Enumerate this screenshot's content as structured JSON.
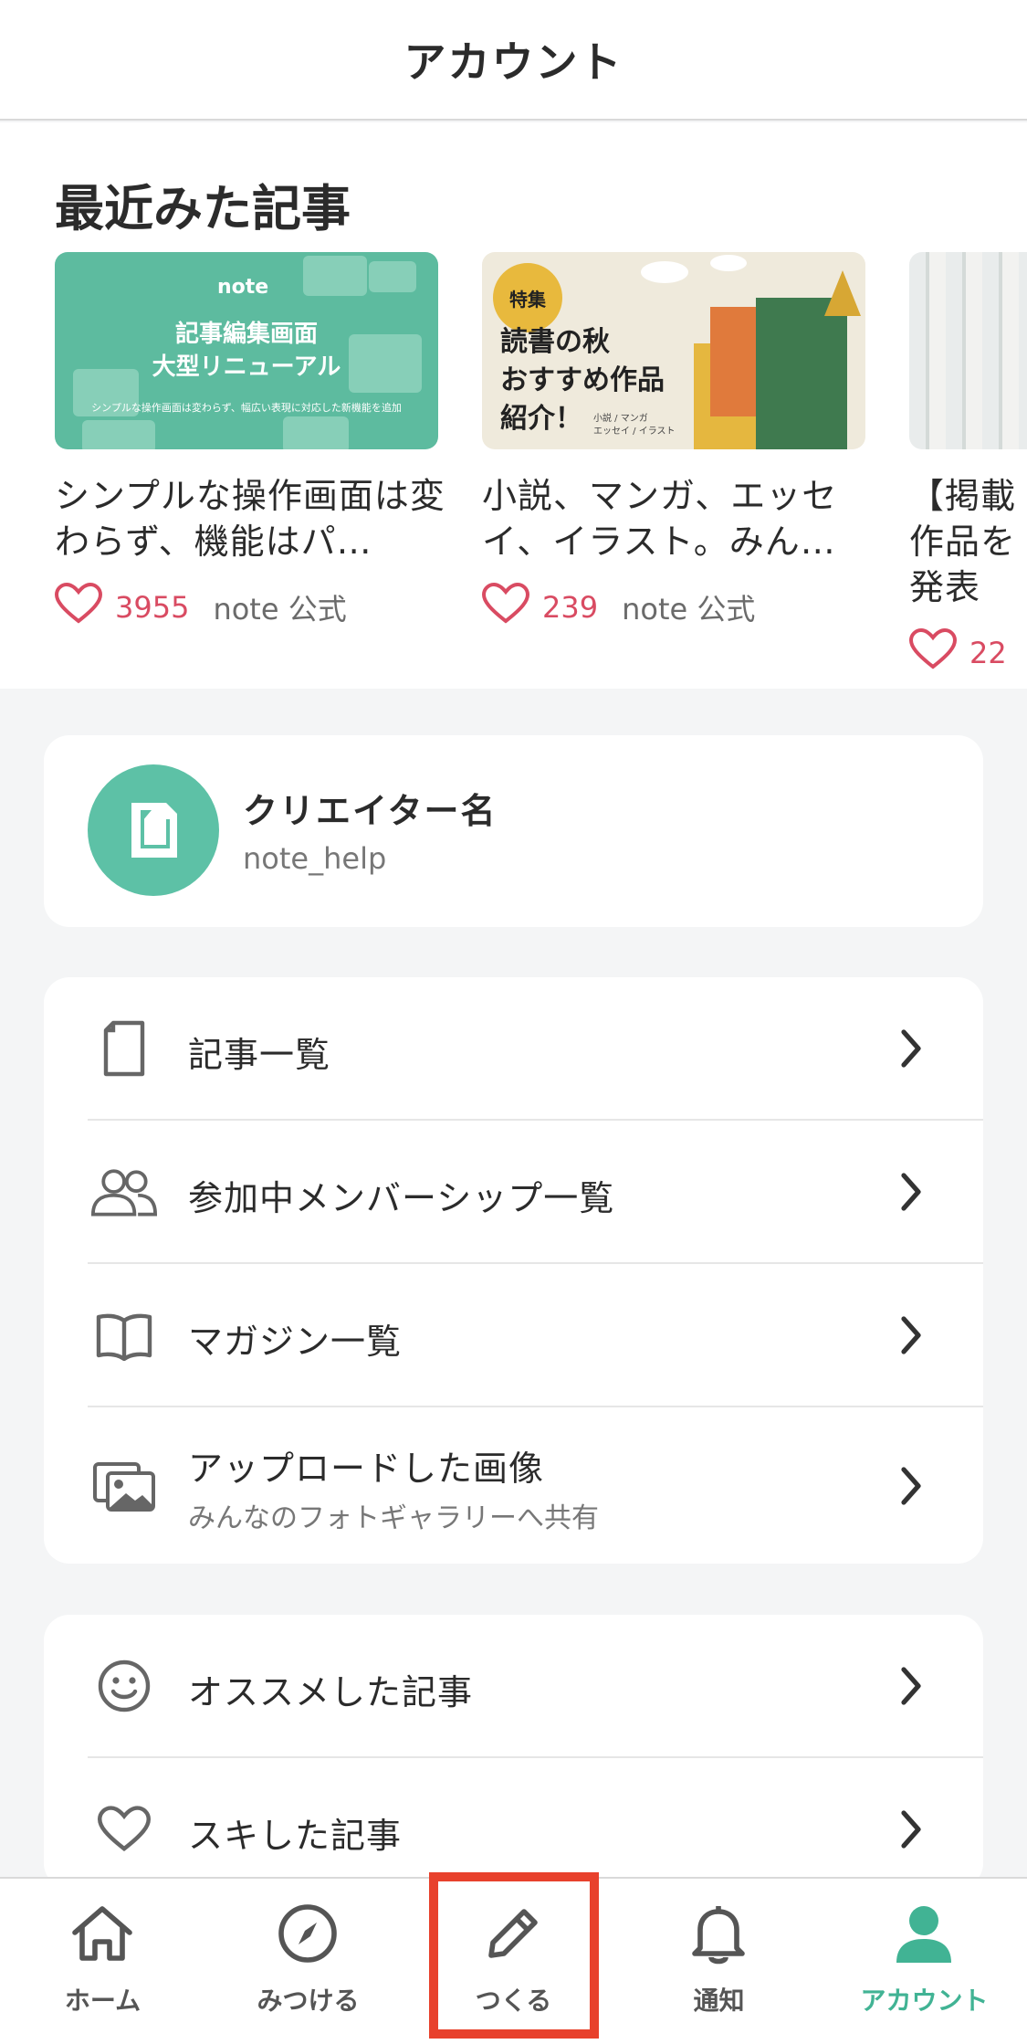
{
  "header": {
    "title": "アカウント"
  },
  "recent": {
    "heading": "最近みた記事",
    "cards": [
      {
        "thumb": {
          "logo": "note",
          "title_line1": "記事編集画面",
          "title_line2": "大型リニューアル",
          "subtitle": "シンプルな操作画面は変わらず、幅広い表現に対応した新機能を追加"
        },
        "description": "シンプルな操作画面は変わらず、機能はパ…",
        "likes": "3955",
        "author": "note 公式"
      },
      {
        "thumb": {
          "badge": "特集",
          "line1": "読書の秋",
          "line2": "おすすめ作品",
          "line3": "紹介！",
          "sub1": "小説 / マンガ",
          "sub2": "エッセイ / イラスト"
        },
        "description": "小説、マンガ、エッセイ、イラスト。みん…",
        "likes": "239",
        "author": "note 公式"
      },
      {
        "description": "【掲載作品を発表",
        "likes": "22",
        "author": ""
      }
    ]
  },
  "profile": {
    "name": "クリエイター名",
    "id": "note_help"
  },
  "menu": [
    {
      "label": "記事一覧",
      "icon": "document-icon"
    },
    {
      "label": "参加中メンバーシップ一覧",
      "icon": "members-icon"
    },
    {
      "label": "マガジン一覧",
      "icon": "book-icon"
    },
    {
      "label": "アップロードした画像",
      "sub": "みんなのフォトギャラリーへ共有",
      "icon": "images-icon"
    }
  ],
  "menu2": [
    {
      "label": "オススメした記事",
      "icon": "smile-icon"
    },
    {
      "label": "スキした記事",
      "icon": "heart-icon"
    }
  ],
  "tabs": [
    {
      "label": "ホーム",
      "icon": "home-icon"
    },
    {
      "label": "みつける",
      "icon": "compass-icon"
    },
    {
      "label": "つくる",
      "icon": "pencil-icon"
    },
    {
      "label": "通知",
      "icon": "bell-icon"
    },
    {
      "label": "アカウント",
      "icon": "person-icon",
      "active": true
    }
  ],
  "colors": {
    "accent": "#41b394",
    "like": "#d94b62",
    "highlight": "#e8412c"
  }
}
